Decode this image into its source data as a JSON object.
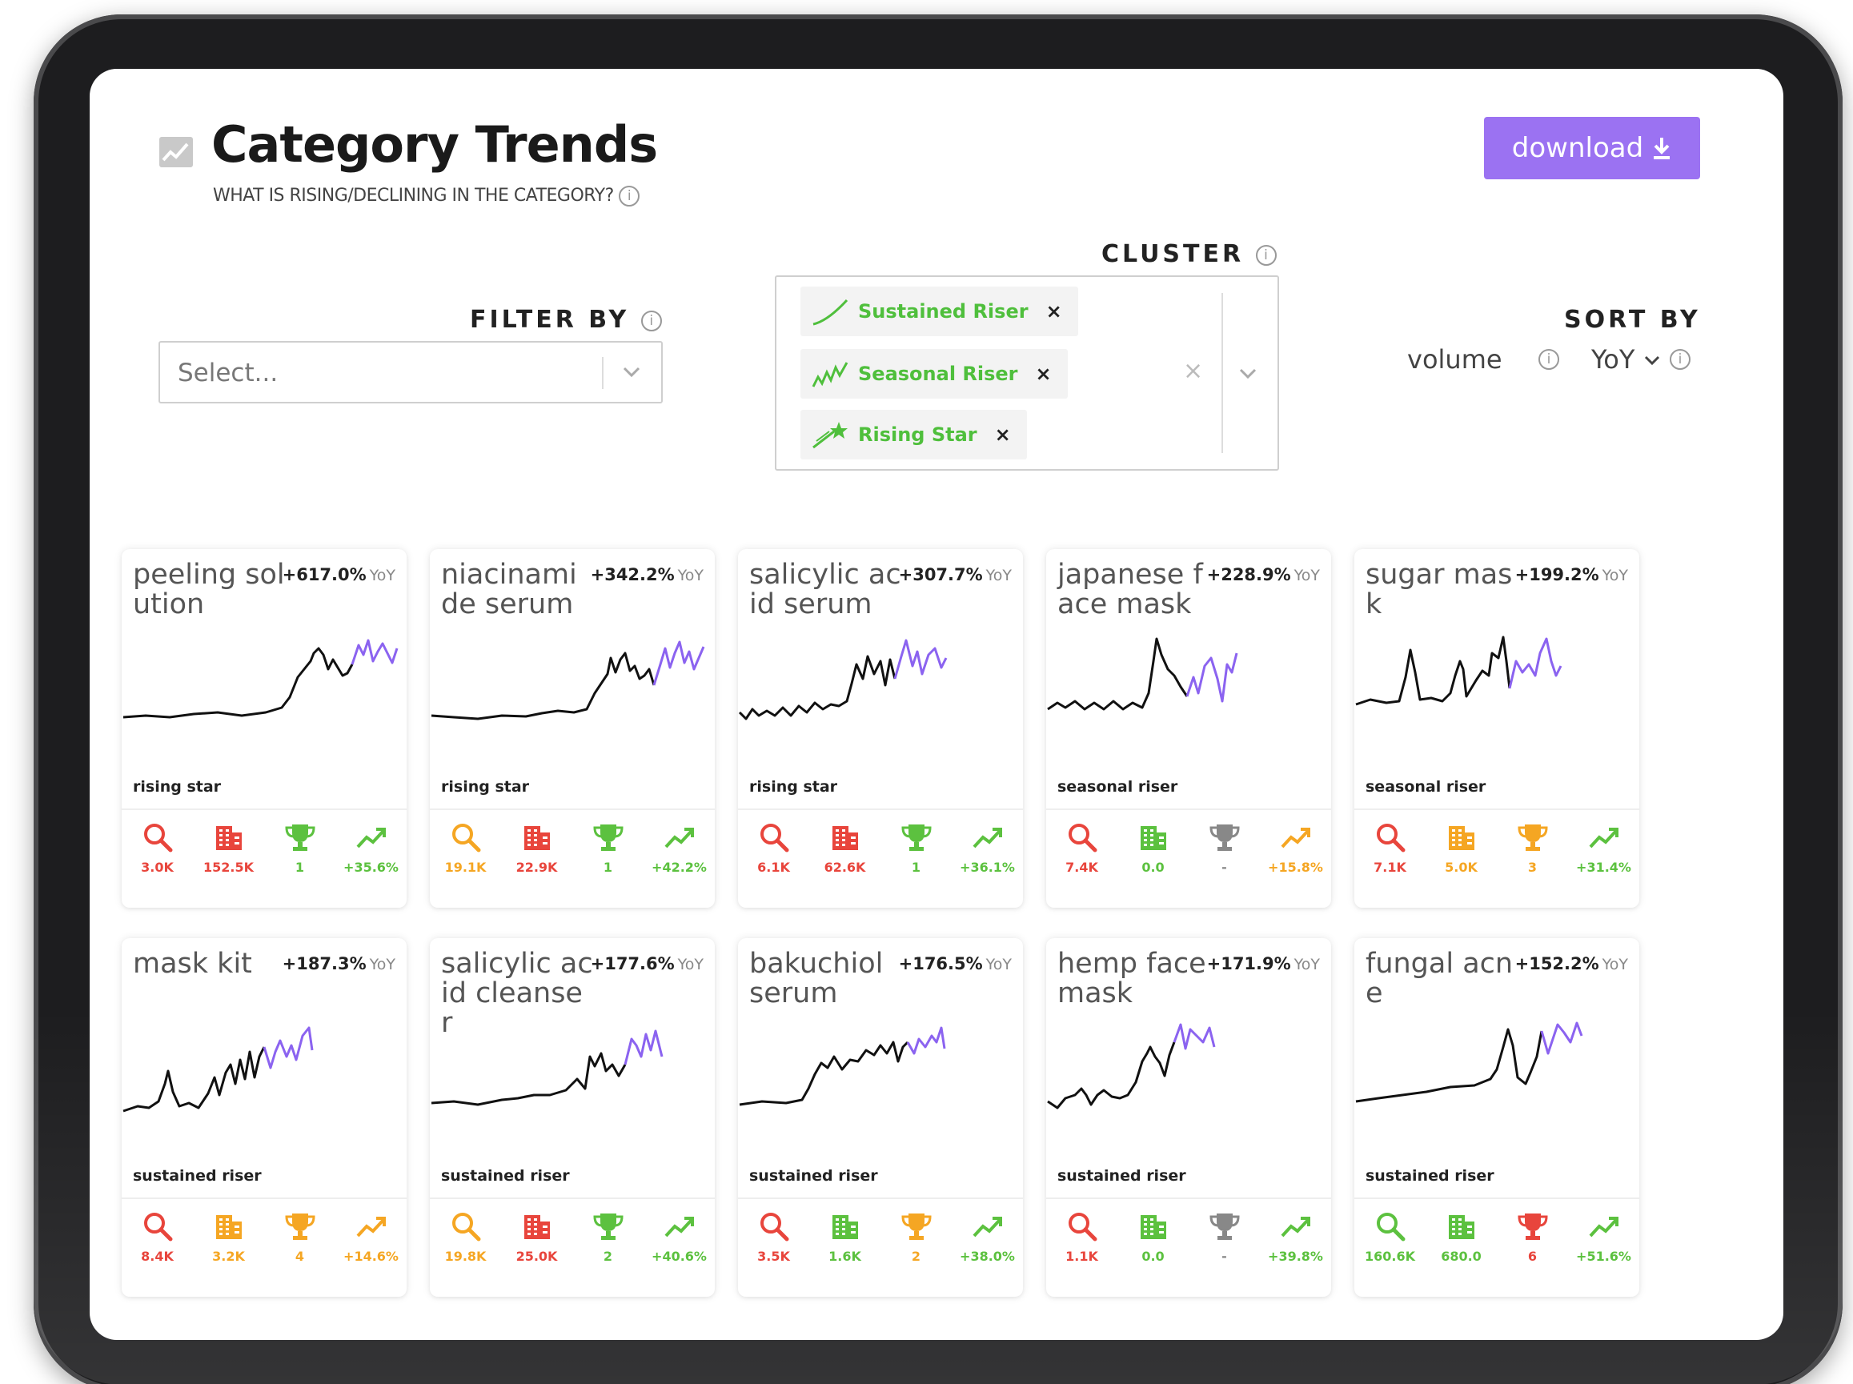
{
  "colors": {
    "accent": "#9b72f2",
    "chip_green": "#4fbf3c",
    "red": "#e8453c",
    "orange": "#f5a623",
    "green": "#5cc13f",
    "gray": "#888888",
    "spark_black": "#111111",
    "spark_purple": "#8b63f0"
  },
  "header": {
    "title": "Category Trends",
    "subtitle": "WHAT IS RISING/DECLINING IN THE CATEGORY?",
    "title_icon": "trend-chart-icon",
    "download_label": "download"
  },
  "filters": {
    "filter_by_label": "FILTER BY",
    "filter_placeholder": "Select...",
    "cluster_label": "CLUSTER",
    "cluster_chips": [
      {
        "label": "Sustained Riser",
        "icon": "sustained-riser-icon"
      },
      {
        "label": "Seasonal Riser",
        "icon": "seasonal-riser-icon"
      },
      {
        "label": "Rising Star",
        "icon": "rising-star-icon"
      }
    ],
    "sort_by_label": "SORT BY",
    "sort_options": [
      "volume",
      "YoY"
    ],
    "sort_selected": "YoY"
  },
  "cards": [
    {
      "name": "peeling solution",
      "yoy": "+617.0%",
      "yoy_unit": "YoY",
      "cluster": "rising star",
      "metrics": [
        {
          "icon": "search-icon",
          "value": "3.0K",
          "color": "#e8453c"
        },
        {
          "icon": "building-icon",
          "value": "152.5K",
          "color": "#e8453c"
        },
        {
          "icon": "trophy-icon",
          "value": "1",
          "color": "#5cc13f"
        },
        {
          "icon": "trend-up-icon",
          "value": "+35.6%",
          "color": "#5cc13f"
        }
      ]
    },
    {
      "name": "niacinamide serum",
      "yoy": "+342.2%",
      "yoy_unit": "YoY",
      "cluster": "rising star",
      "metrics": [
        {
          "icon": "search-icon",
          "value": "19.1K",
          "color": "#f5a623"
        },
        {
          "icon": "building-icon",
          "value": "22.9K",
          "color": "#e8453c"
        },
        {
          "icon": "trophy-icon",
          "value": "1",
          "color": "#5cc13f"
        },
        {
          "icon": "trend-up-icon",
          "value": "+42.2%",
          "color": "#5cc13f"
        }
      ]
    },
    {
      "name": "salicylic acid serum",
      "yoy": "+307.7%",
      "yoy_unit": "YoY",
      "cluster": "rising star",
      "metrics": [
        {
          "icon": "search-icon",
          "value": "6.1K",
          "color": "#e8453c"
        },
        {
          "icon": "building-icon",
          "value": "62.6K",
          "color": "#e8453c"
        },
        {
          "icon": "trophy-icon",
          "value": "1",
          "color": "#5cc13f"
        },
        {
          "icon": "trend-up-icon",
          "value": "+36.1%",
          "color": "#5cc13f"
        }
      ]
    },
    {
      "name": "japanese face mask",
      "yoy": "+228.9%",
      "yoy_unit": "YoY",
      "cluster": "seasonal riser",
      "metrics": [
        {
          "icon": "search-icon",
          "value": "7.4K",
          "color": "#e8453c"
        },
        {
          "icon": "building-icon",
          "value": "0.0",
          "color": "#5cc13f"
        },
        {
          "icon": "trophy-icon",
          "value": "-",
          "color": "#888888"
        },
        {
          "icon": "trend-up-icon",
          "value": "+15.8%",
          "color": "#f5a623"
        }
      ]
    },
    {
      "name": "sugar mask",
      "yoy": "+199.2%",
      "yoy_unit": "YoY",
      "cluster": "seasonal riser",
      "metrics": [
        {
          "icon": "search-icon",
          "value": "7.1K",
          "color": "#e8453c"
        },
        {
          "icon": "building-icon",
          "value": "5.0K",
          "color": "#f5a623"
        },
        {
          "icon": "trophy-icon",
          "value": "3",
          "color": "#f5a623"
        },
        {
          "icon": "trend-up-icon",
          "value": "+31.4%",
          "color": "#5cc13f"
        }
      ]
    },
    {
      "name": "mask kit",
      "yoy": "+187.3%",
      "yoy_unit": "YoY",
      "cluster": "sustained riser",
      "metrics": [
        {
          "icon": "search-icon",
          "value": "8.4K",
          "color": "#e8453c"
        },
        {
          "icon": "building-icon",
          "value": "3.2K",
          "color": "#f5a623"
        },
        {
          "icon": "trophy-icon",
          "value": "4",
          "color": "#f5a623"
        },
        {
          "icon": "trend-up-icon",
          "value": "+14.6%",
          "color": "#f5a623"
        }
      ]
    },
    {
      "name": "salicylic acid cleanser",
      "yoy": "+177.6%",
      "yoy_unit": "YoY",
      "cluster": "sustained riser",
      "metrics": [
        {
          "icon": "search-icon",
          "value": "19.8K",
          "color": "#f5a623"
        },
        {
          "icon": "building-icon",
          "value": "25.0K",
          "color": "#e8453c"
        },
        {
          "icon": "trophy-icon",
          "value": "2",
          "color": "#5cc13f"
        },
        {
          "icon": "trend-up-icon",
          "value": "+40.6%",
          "color": "#5cc13f"
        }
      ]
    },
    {
      "name": "bakuchiol serum",
      "yoy": "+176.5%",
      "yoy_unit": "YoY",
      "cluster": "sustained riser",
      "metrics": [
        {
          "icon": "search-icon",
          "value": "3.5K",
          "color": "#e8453c"
        },
        {
          "icon": "building-icon",
          "value": "1.6K",
          "color": "#5cc13f"
        },
        {
          "icon": "trophy-icon",
          "value": "2",
          "color": "#f5a623"
        },
        {
          "icon": "trend-up-icon",
          "value": "+38.0%",
          "color": "#5cc13f"
        }
      ]
    },
    {
      "name": "hemp face mask",
      "yoy": "+171.9%",
      "yoy_unit": "YoY",
      "cluster": "sustained riser",
      "metrics": [
        {
          "icon": "search-icon",
          "value": "1.1K",
          "color": "#e8453c"
        },
        {
          "icon": "building-icon",
          "value": "0.0",
          "color": "#5cc13f"
        },
        {
          "icon": "trophy-icon",
          "value": "-",
          "color": "#888888"
        },
        {
          "icon": "trend-up-icon",
          "value": "+39.8%",
          "color": "#5cc13f"
        }
      ]
    },
    {
      "name": "fungal acne",
      "yoy": "+152.2%",
      "yoy_unit": "YoY",
      "cluster": "sustained riser",
      "metrics": [
        {
          "icon": "search-icon",
          "value": "160.6K",
          "color": "#5cc13f"
        },
        {
          "icon": "building-icon",
          "value": "680.0",
          "color": "#5cc13f"
        },
        {
          "icon": "trophy-icon",
          "value": "6",
          "color": "#e8453c"
        },
        {
          "icon": "trend-up-icon",
          "value": "+51.6%",
          "color": "#5cc13f"
        }
      ]
    }
  ]
}
